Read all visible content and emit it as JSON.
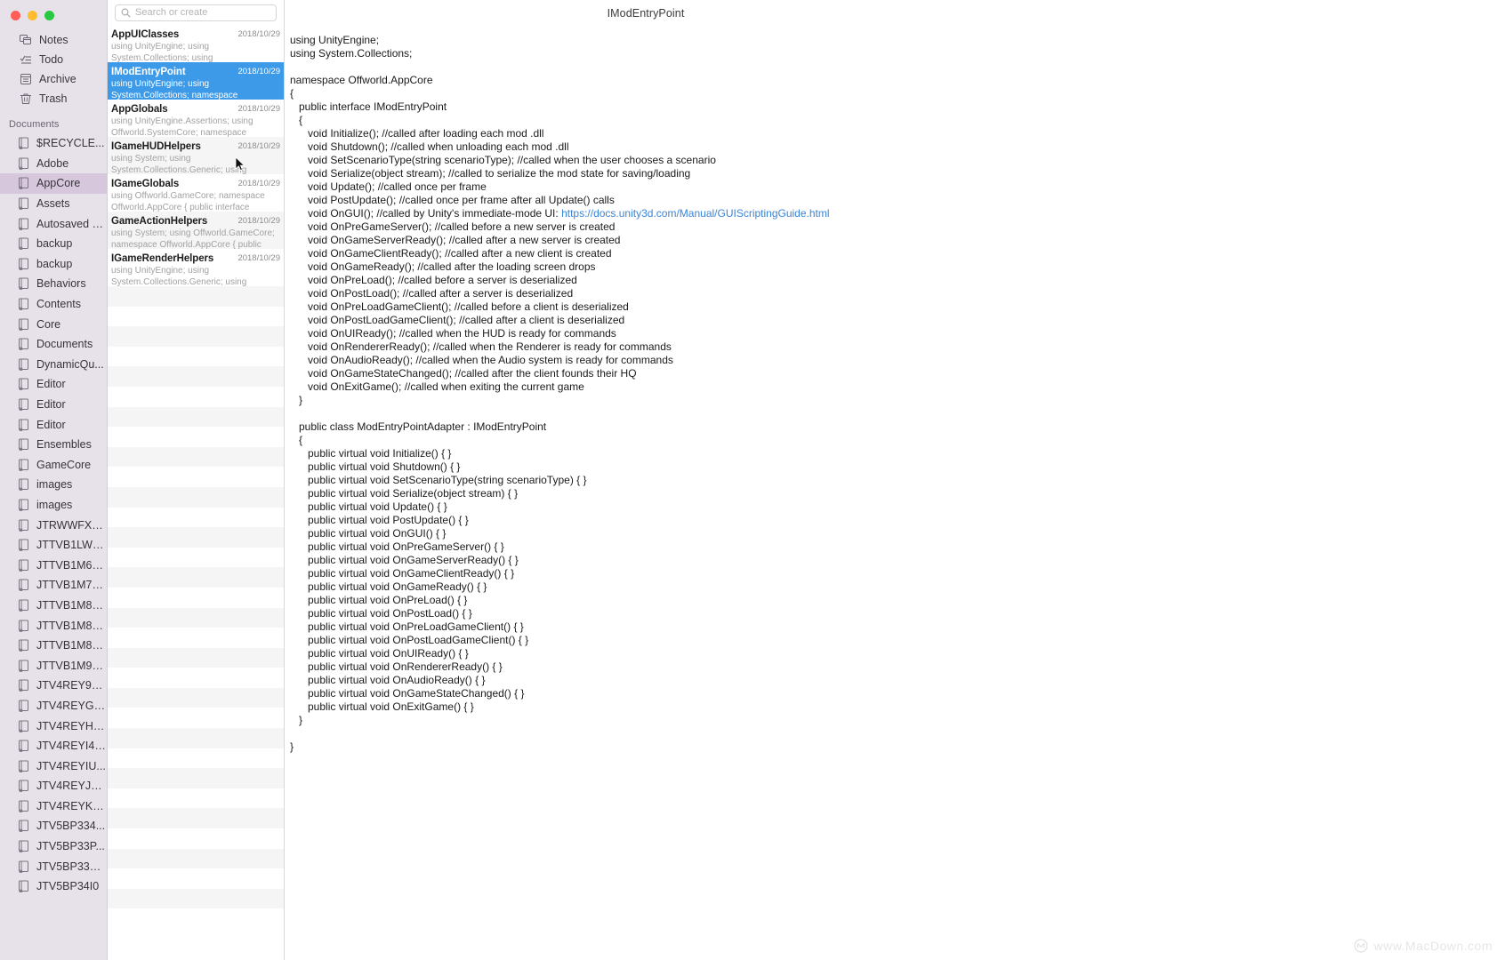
{
  "window": {
    "title": "IModEntryPoint",
    "traffic_lights": [
      "close",
      "minimize",
      "zoom"
    ]
  },
  "sidebar": {
    "nav": [
      {
        "label": "Notes",
        "icon": "notes-icon"
      },
      {
        "label": "Todo",
        "icon": "todo-icon"
      },
      {
        "label": "Archive",
        "icon": "archive-icon"
      },
      {
        "label": "Trash",
        "icon": "trash-icon"
      }
    ],
    "section_label": "Documents",
    "selected_folder": "AppCore",
    "folders": [
      "$RECYCLE...",
      "Adobe",
      "AppCore",
      "Assets",
      "Autosaved C...",
      "backup",
      "backup",
      "Behaviors",
      "Contents",
      "Core",
      "Documents",
      "DynamicQu...",
      "Editor",
      "Editor",
      "Editor",
      "Ensembles",
      "GameCore",
      "images",
      "images",
      "JTRWWFXK...",
      "JTTVB1LWT...",
      "JTTVB1M6O...",
      "JTTVB1M7G...",
      "JTTVB1M8O...",
      "JTTVB1M8D...",
      "JTTVB1M8S...",
      "JTTVB1M9S...",
      "JTV4REY9L...",
      "JTV4REYGF...",
      "JTV4REYHP...",
      "JTV4REYI41...",
      "JTV4REYIU...",
      "JTV4REYJQ...",
      "JTV4REYK5...",
      "JTV5BP334...",
      "JTV5BP33P...",
      "JTV5BP33Q...",
      "JTV5BP34I0"
    ]
  },
  "search": {
    "placeholder": "Search or create",
    "value": "",
    "icon": "search-icon"
  },
  "notes": [
    {
      "title": "AppUIClasses",
      "date": "2018/10/29",
      "preview": "using UnityEngine; using System.Collections; using",
      "selected": false
    },
    {
      "title": "IModEntryPoint",
      "date": "2018/10/29",
      "preview": "using UnityEngine; using System.Collections; namespace",
      "selected": true
    },
    {
      "title": "AppGlobals",
      "date": "2018/10/29",
      "preview": "using UnityEngine.Assertions; using Offworld.SystemCore; namespace",
      "selected": false
    },
    {
      "title": "IGameHUDHelpers",
      "date": "2018/10/29",
      "preview": "using System; using System.Collections.Generic; using",
      "selected": false
    },
    {
      "title": "IGameGlobals",
      "date": "2018/10/29",
      "preview": "using Offworld.GameCore; namespace Offworld.AppCore { public interface",
      "selected": false
    },
    {
      "title": "GameActionHelpers",
      "date": "2018/10/29",
      "preview": "using System; using Offworld.GameCore; namespace Offworld.AppCore { public",
      "selected": false
    },
    {
      "title": "IGameRenderHelpers",
      "date": "2018/10/29",
      "preview": "using UnityEngine; using System.Collections.Generic; using",
      "selected": false
    }
  ],
  "editor": {
    "link_text": "https://docs.unity3d.com/Manual/GUIScriptingGuide.html",
    "code_before_link": "using UnityEngine;\nusing System.Collections;\n\nnamespace Offworld.AppCore\n{\n   public interface IModEntryPoint\n   {\n      void Initialize(); //called after loading each mod .dll\n      void Shutdown(); //called when unloading each mod .dll\n      void SetScenarioType(string scenarioType); //called when the user chooses a scenario\n      void Serialize(object stream); //called to serialize the mod state for saving/loading\n      void Update(); //called once per frame\n      void PostUpdate(); //called once per frame after all Update() calls\n      void OnGUI(); //called by Unity's immediate-mode UI: ",
    "code_after_link": "\n      void OnPreGameServer(); //called before a new server is created\n      void OnGameServerReady(); //called after a new server is created\n      void OnGameClientReady(); //called after a new client is created\n      void OnGameReady(); //called after the loading screen drops\n      void OnPreLoad(); //called before a server is deserialized\n      void OnPostLoad(); //called after a server is deserialized\n      void OnPreLoadGameClient(); //called before a client is deserialized\n      void OnPostLoadGameClient(); //called after a client is deserialized\n      void OnUIReady(); //called when the HUD is ready for commands\n      void OnRendererReady(); //called when the Renderer is ready for commands\n      void OnAudioReady(); //called when the Audio system is ready for commands\n      void OnGameStateChanged(); //called after the client founds their HQ\n      void OnExitGame(); //called when exiting the current game\n   }\n\n   public class ModEntryPointAdapter : IModEntryPoint\n   {\n      public virtual void Initialize() { }\n      public virtual void Shutdown() { }\n      public virtual void SetScenarioType(string scenarioType) { }\n      public virtual void Serialize(object stream) { }\n      public virtual void Update() { }\n      public virtual void PostUpdate() { }\n      public virtual void OnGUI() { }\n      public virtual void OnPreGameServer() { }\n      public virtual void OnGameServerReady() { }\n      public virtual void OnGameClientReady() { }\n      public virtual void OnGameReady() { }\n      public virtual void OnPreLoad() { }\n      public virtual void OnPostLoad() { }\n      public virtual void OnPreLoadGameClient() { }\n      public virtual void OnPostLoadGameClient() { }\n      public virtual void OnUIReady() { }\n      public virtual void OnRendererReady() { }\n      public virtual void OnAudioReady() { }\n      public virtual void OnGameStateChanged() { }\n      public virtual void OnExitGame() { }\n   }\n\n}"
  },
  "watermark": {
    "text": "www.MacDown.com",
    "icon": "macdown-logo-icon"
  },
  "colors": {
    "selection_blue": "#3d9ae8",
    "sidebar_bg": "#e7e2e9",
    "folder_selected": "#d7c7dc",
    "link": "#3a84d8",
    "traffic_red": "#ff5f57",
    "traffic_yellow": "#febc2e",
    "traffic_green": "#28c840"
  }
}
